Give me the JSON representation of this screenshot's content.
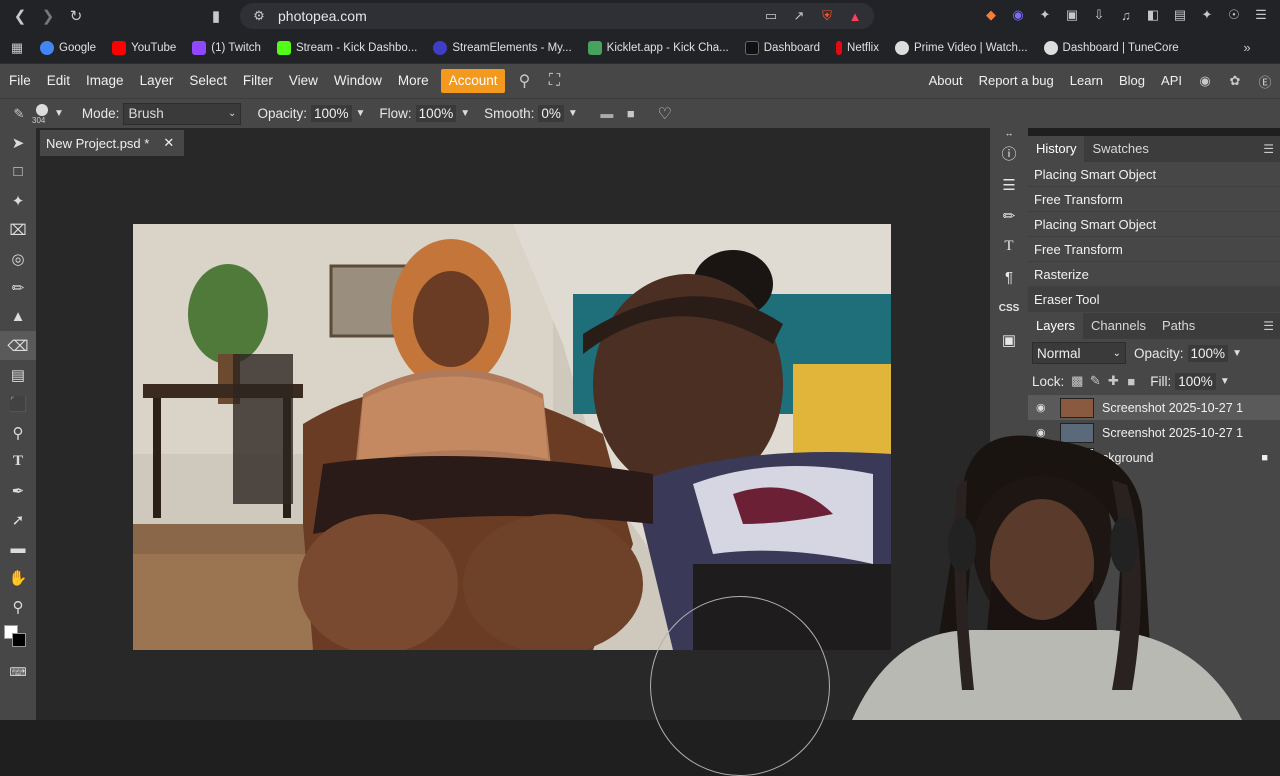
{
  "browser": {
    "url": "photopea.com",
    "bookmarks": [
      {
        "label": "Google",
        "color": "#4285f4"
      },
      {
        "label": "YouTube",
        "color": "#ff0000"
      },
      {
        "label": "(1) Twitch",
        "color": "#9146ff"
      },
      {
        "label": "Stream - Kick Dashbo...",
        "color": "#53fc18"
      },
      {
        "label": "StreamElements - My...",
        "color": "#3e3ec7"
      },
      {
        "label": "Kicklet.app - Kick Cha...",
        "color": "#46a35e"
      },
      {
        "label": "Dashboard",
        "color": "#222222"
      },
      {
        "label": "Netflix",
        "color": "#e50914"
      },
      {
        "label": "Prime Video | Watch...",
        "color": "#dddddd"
      },
      {
        "label": "Dashboard | TuneCore",
        "color": "#dddddd"
      }
    ]
  },
  "menu": {
    "items": [
      "File",
      "Edit",
      "Image",
      "Layer",
      "Select",
      "Filter",
      "View",
      "Window",
      "More"
    ],
    "account": "Account",
    "right": [
      "About",
      "Report a bug",
      "Learn",
      "Blog",
      "API"
    ]
  },
  "options": {
    "brush_size": "304",
    "mode_label": "Mode:",
    "mode_value": "Brush",
    "opacity_label": "Opacity:",
    "opacity_value": "100%",
    "flow_label": "Flow:",
    "flow_value": "100%",
    "smooth_label": "Smooth:",
    "smooth_value": "0%"
  },
  "document": {
    "tab_title": "New Project.psd *"
  },
  "history": {
    "tabs": [
      "History",
      "Swatches"
    ],
    "items": [
      "Placing Smart Object",
      "Free Transform",
      "Placing Smart Object",
      "Free Transform",
      "Rasterize",
      "Eraser Tool"
    ]
  },
  "layers": {
    "tabs": [
      "Layers",
      "Channels",
      "Paths"
    ],
    "blend_mode": "Normal",
    "opacity_label": "Opacity:",
    "opacity_value": "100%",
    "lock_label": "Lock:",
    "fill_label": "Fill:",
    "fill_value": "100%",
    "items": [
      {
        "name": "Screenshot 2025-10-27 1"
      },
      {
        "name": "Screenshot 2025-10-27 1"
      },
      {
        "name": "ckground"
      }
    ]
  },
  "colors": {
    "accent": "#f39a1e",
    "panel_bg": "#474747",
    "workspace_bg": "#282828"
  }
}
